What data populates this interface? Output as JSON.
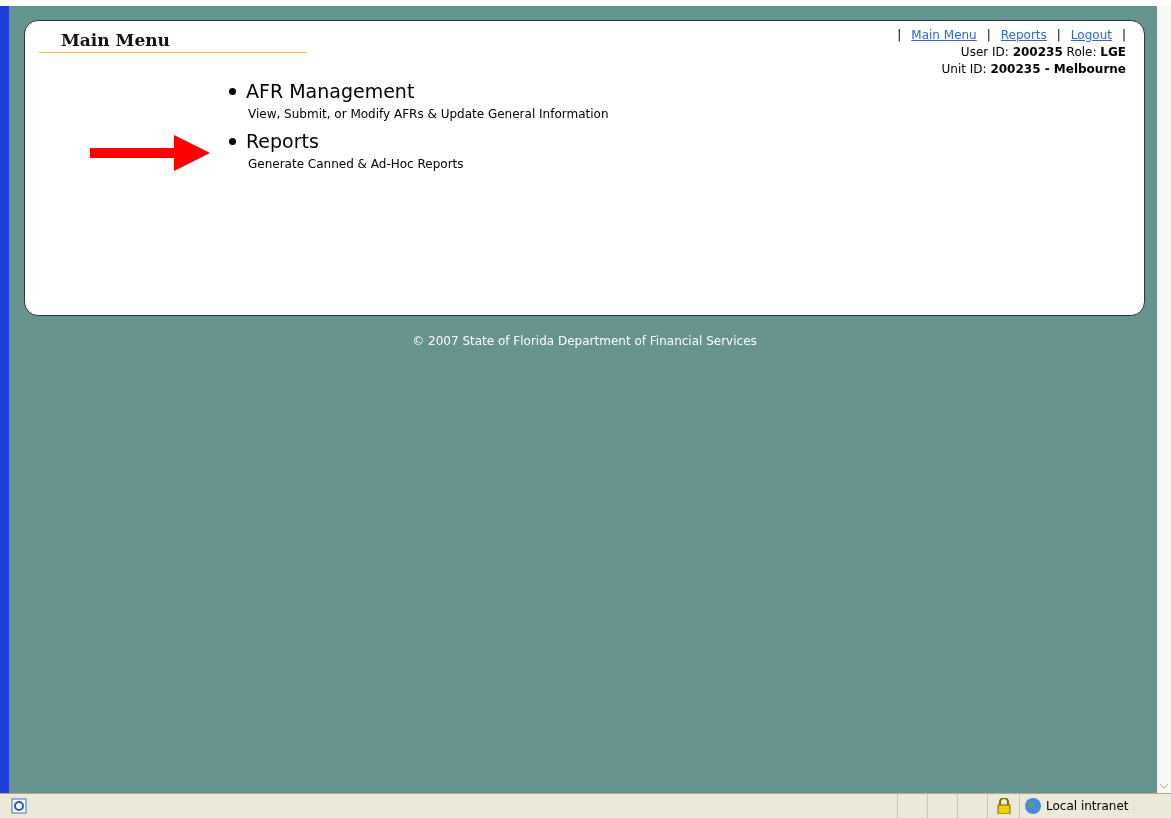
{
  "page": {
    "title": "Main Menu"
  },
  "nav": {
    "separator": "|",
    "links": [
      "Main Menu",
      "Reports",
      "Logout"
    ]
  },
  "user_info": [
    "User ID: **200235** Role: **LGE**",
    "Unit ID: **200235 - Melbourne**"
  ],
  "menu": [
    {
      "title": "AFR Management",
      "description": "View, Submit, or Modify AFRs & Update General Information",
      "pointed": false
    },
    {
      "title": "Reports",
      "description": "Generate Canned & Ad-Hoc Reports",
      "pointed": true
    }
  ],
  "footer": "© 2007 State of Florida Department of Financial Services",
  "status_bar": {
    "zone": "Local intranet"
  }
}
